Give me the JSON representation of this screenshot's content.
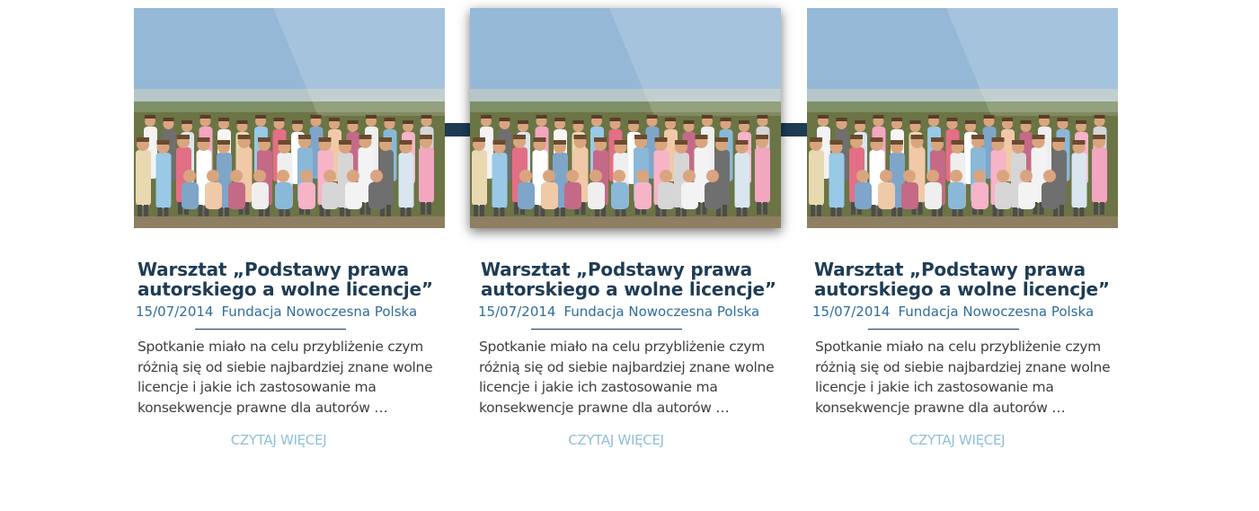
{
  "colors": {
    "title": "#1f3c55",
    "meta": "#2f6e9c",
    "excerpt": "#3f3f3f",
    "read_more": "#8fc0d6",
    "connector": "#1f3c55"
  },
  "posts": [
    {
      "image_icon": "group-photo",
      "title": "Warsztat „Podstawy prawa autorskiego a wolne licencje”",
      "date": "15/07/2014",
      "author": "Fundacja Nowoczesna Polska",
      "excerpt": "Spotkanie miało na celu przybliżenie czym różnią się od siebie najbardziej znane wolne licencje i jakie ich zastosowanie ma konsekwencje prawne dla autorów …",
      "read_more": "CZYTAJ WIĘCEJ"
    },
    {
      "image_icon": "group-photo",
      "title": "Warsztat „Podstawy prawa autorskiego a wolne licencje”",
      "date": "15/07/2014",
      "author": "Fundacja Nowoczesna Polska",
      "excerpt": "Spotkanie miało na celu przybliżenie czym różnią się od siebie najbardziej znane wolne licencje i jakie ich zastosowanie ma konsekwencje prawne dla autorów …",
      "read_more": "CZYTAJ WIĘCEJ"
    },
    {
      "image_icon": "group-photo",
      "title": "Warsztat „Podstawy prawa autorskiego a wolne licencje”",
      "date": "15/07/2014",
      "author": "Fundacja Nowoczesna Polska",
      "excerpt": "Spotkanie miało na celu przybliżenie czym różnią się od siebie najbardziej znane wolne licencje i jakie ich zastosowanie ma konsekwencje prawne dla autorów …",
      "read_more": "CZYTAJ WIĘCEJ"
    }
  ]
}
